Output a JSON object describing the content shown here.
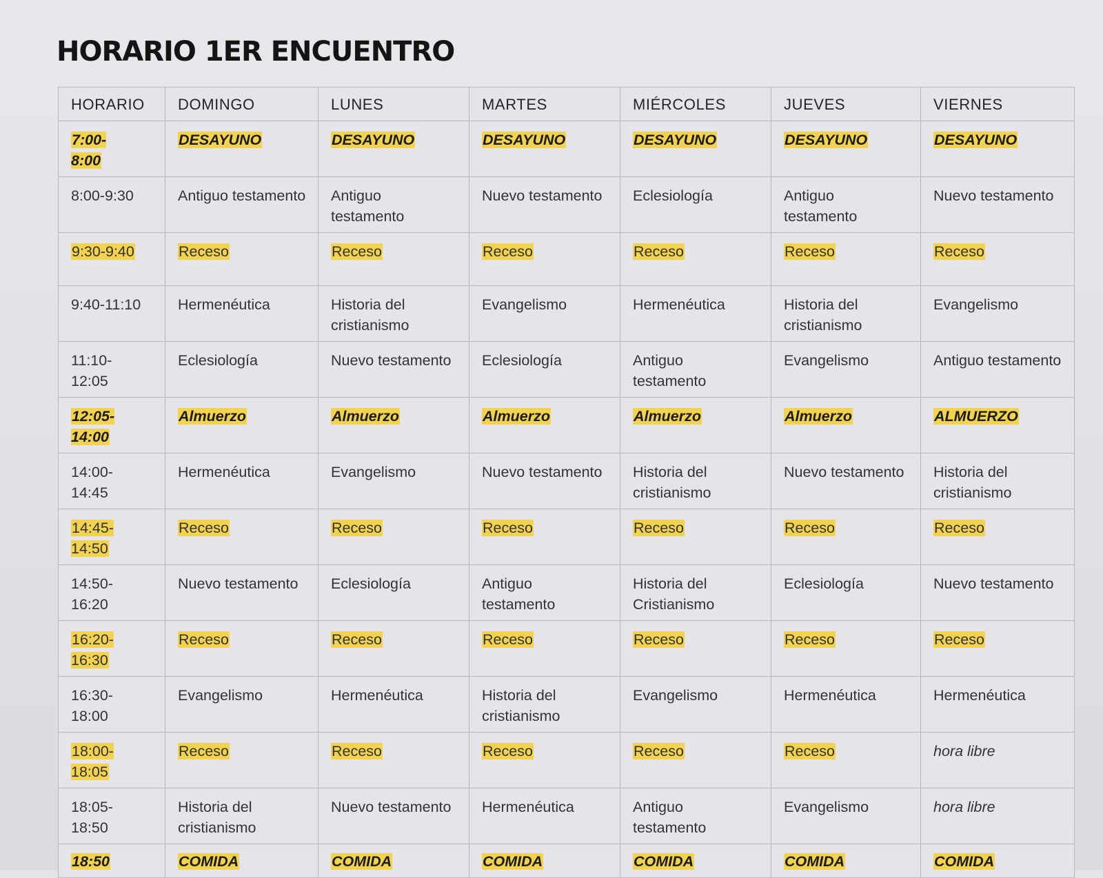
{
  "title": "HORARIO 1ER ENCUENTRO",
  "colors": {
    "highlight": "#f3d24f",
    "grid": "#b7b7bf",
    "background": "#e3e3e8"
  },
  "headers": [
    "HORARIO",
    "DOMINGO",
    "LUNES",
    "MARTES",
    "MIÉRCOLES",
    "JUEVES",
    "VIERNES"
  ],
  "rows": [
    {
      "time": [
        "7:00-",
        "8:00"
      ],
      "time_style": "strong",
      "cells": [
        {
          "text": "DESAYUNO",
          "style": "strong"
        },
        {
          "text": "DESAYUNO",
          "style": "strong"
        },
        {
          "text": "DESAYUNO",
          "style": "strong"
        },
        {
          "text": "DESAYUNO",
          "style": "strong"
        },
        {
          "text": "DESAYUNO",
          "style": "strong"
        },
        {
          "text": "DESAYUNO",
          "style": "strong"
        }
      ]
    },
    {
      "time": [
        "8:00-9:30"
      ],
      "time_style": "plain",
      "cells": [
        {
          "text": "Antiguo testamento",
          "style": "plain"
        },
        {
          "text": "Antiguo testamento",
          "style": "plain"
        },
        {
          "text": "Nuevo testamento",
          "style": "plain"
        },
        {
          "text": "Eclesiología",
          "style": "plain"
        },
        {
          "text": "Antiguo testamento",
          "style": "plain"
        },
        {
          "text": "Nuevo testamento",
          "style": "plain"
        }
      ]
    },
    {
      "time": [
        "9:30-9:40"
      ],
      "time_style": "highlight",
      "cells": [
        {
          "text": "Receso",
          "style": "highlight"
        },
        {
          "text": "Receso",
          "style": "highlight"
        },
        {
          "text": "Receso",
          "style": "highlight"
        },
        {
          "text": "Receso",
          "style": "highlight"
        },
        {
          "text": "Receso",
          "style": "highlight"
        },
        {
          "text": "Receso",
          "style": "highlight"
        }
      ]
    },
    {
      "time": [
        "9:40-11:10"
      ],
      "time_style": "plain",
      "cells": [
        {
          "text": "Hermenéutica",
          "style": "plain"
        },
        {
          "text": "Historia del cristianismo",
          "style": "plain"
        },
        {
          "text": "Evangelismo",
          "style": "plain"
        },
        {
          "text": "Hermenéutica",
          "style": "plain"
        },
        {
          "text": "Historia del cristianismo",
          "style": "plain"
        },
        {
          "text": "Evangelismo",
          "style": "plain"
        }
      ]
    },
    {
      "time": [
        "11:10-",
        "12:05"
      ],
      "time_style": "plain",
      "cells": [
        {
          "text": "Eclesiología",
          "style": "plain"
        },
        {
          "text": "Nuevo testamento",
          "style": "plain"
        },
        {
          "text": "Eclesiología",
          "style": "plain"
        },
        {
          "text": "Antiguo testamento",
          "style": "plain"
        },
        {
          "text": "Evangelismo",
          "style": "plain"
        },
        {
          "text": "Antiguo testamento",
          "style": "plain"
        }
      ]
    },
    {
      "time": [
        "12:05-",
        "14:00"
      ],
      "time_style": "strong",
      "cells": [
        {
          "text": "Almuerzo",
          "style": "strong"
        },
        {
          "text": "Almuerzo",
          "style": "strong"
        },
        {
          "text": "Almuerzo",
          "style": "strong"
        },
        {
          "text": "Almuerzo",
          "style": "strong"
        },
        {
          "text": "Almuerzo",
          "style": "strong"
        },
        {
          "text": "ALMUERZO",
          "style": "strong"
        }
      ]
    },
    {
      "time": [
        "14:00-",
        "14:45"
      ],
      "time_style": "plain",
      "cells": [
        {
          "text": "Hermenéutica",
          "style": "plain"
        },
        {
          "text": "Evangelismo",
          "style": "plain"
        },
        {
          "text": "Nuevo testamento",
          "style": "plain"
        },
        {
          "text": "Historia del cristianismo",
          "style": "plain"
        },
        {
          "text": "Nuevo testamento",
          "style": "plain"
        },
        {
          "text": "Historia del cristianismo",
          "style": "plain"
        }
      ]
    },
    {
      "time": [
        "14:45-",
        "14:50"
      ],
      "time_style": "highlight",
      "cells": [
        {
          "text": "Receso",
          "style": "highlight"
        },
        {
          "text": "Receso",
          "style": "highlight"
        },
        {
          "text": "Receso",
          "style": "highlight"
        },
        {
          "text": "Receso",
          "style": "highlight"
        },
        {
          "text": "Receso",
          "style": "highlight"
        },
        {
          "text": "Receso",
          "style": "highlight"
        }
      ]
    },
    {
      "time": [
        "14:50-",
        "16:20"
      ],
      "time_style": "plain",
      "cells": [
        {
          "text": "Nuevo testamento",
          "style": "plain"
        },
        {
          "text": "Eclesiología",
          "style": "plain"
        },
        {
          "text": "Antiguo testamento",
          "style": "plain"
        },
        {
          "text": "Historia del Cristianismo",
          "style": "plain"
        },
        {
          "text": "Eclesiología",
          "style": "plain"
        },
        {
          "text": "Nuevo testamento",
          "style": "plain"
        }
      ]
    },
    {
      "time": [
        "16:20-",
        "16:30"
      ],
      "time_style": "highlight",
      "cells": [
        {
          "text": "Receso",
          "style": "highlight"
        },
        {
          "text": "Receso",
          "style": "highlight"
        },
        {
          "text": "Receso",
          "style": "highlight"
        },
        {
          "text": "Receso",
          "style": "highlight"
        },
        {
          "text": "Receso",
          "style": "highlight"
        },
        {
          "text": "Receso",
          "style": "highlight"
        }
      ]
    },
    {
      "time": [
        "16:30-",
        "18:00"
      ],
      "time_style": "plain",
      "cells": [
        {
          "text": "Evangelismo",
          "style": "plain"
        },
        {
          "text": "Hermenéutica",
          "style": "plain"
        },
        {
          "text": "Historia del cristianismo",
          "style": "plain"
        },
        {
          "text": "Evangelismo",
          "style": "plain"
        },
        {
          "text": "Hermenéutica",
          "style": "plain"
        },
        {
          "text": "Hermenéutica",
          "style": "plain"
        }
      ]
    },
    {
      "time": [
        "18:00-",
        "18:05"
      ],
      "time_style": "highlight",
      "cells": [
        {
          "text": "Receso",
          "style": "highlight"
        },
        {
          "text": "Receso",
          "style": "highlight"
        },
        {
          "text": "Receso",
          "style": "highlight"
        },
        {
          "text": "Receso",
          "style": "highlight"
        },
        {
          "text": "Receso",
          "style": "highlight"
        },
        {
          "text": "hora libre",
          "style": "italic"
        }
      ]
    },
    {
      "time": [
        "18:05-",
        "18:50"
      ],
      "time_style": "plain",
      "cells": [
        {
          "text": "Historia del cristianismo",
          "style": "plain"
        },
        {
          "text": "Nuevo testamento",
          "style": "plain"
        },
        {
          "text": "Hermenéutica",
          "style": "plain"
        },
        {
          "text": "Antiguo testamento",
          "style": "plain"
        },
        {
          "text": "Evangelismo",
          "style": "plain"
        },
        {
          "text": "hora libre",
          "style": "italic"
        }
      ]
    },
    {
      "time": [
        "18:50"
      ],
      "time_style": "strong",
      "cells": [
        {
          "text": "COMIDA",
          "style": "strong"
        },
        {
          "text": "COMIDA",
          "style": "strong"
        },
        {
          "text": "COMIDA",
          "style": "strong"
        },
        {
          "text": "COMIDA",
          "style": "strong"
        },
        {
          "text": "COMIDA",
          "style": "strong"
        },
        {
          "text": "COMIDA",
          "style": "strong"
        }
      ]
    }
  ]
}
